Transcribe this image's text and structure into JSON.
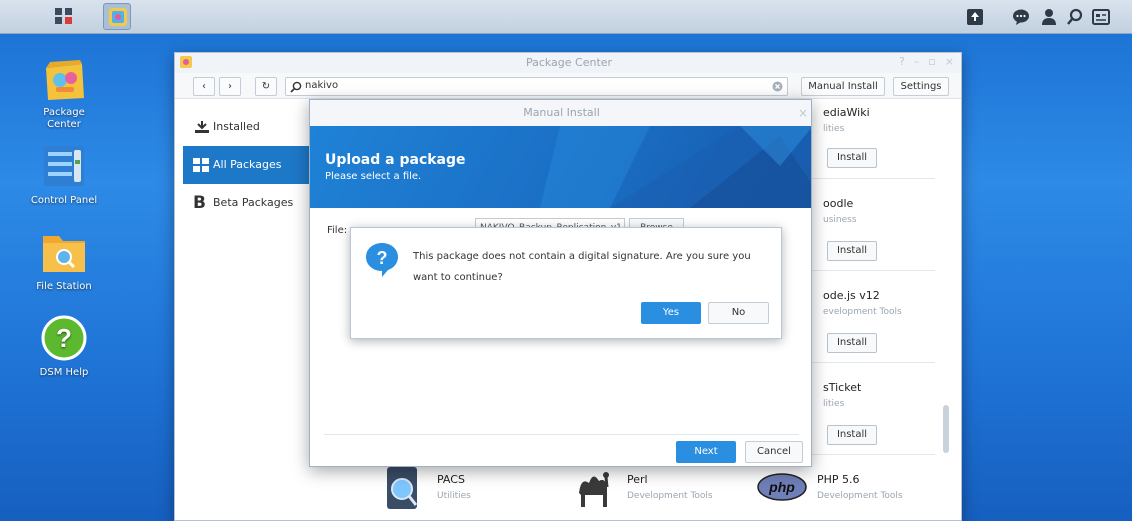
{
  "desktop": {
    "icons": [
      {
        "label": "Package\nCenter"
      },
      {
        "label": "Control Panel"
      },
      {
        "label": "File Station"
      },
      {
        "label": "DSM Help"
      }
    ]
  },
  "package_center": {
    "title": "Package Center",
    "search_value": "nakivo",
    "manual_install_label": "Manual Install",
    "settings_label": "Settings",
    "sidebar": [
      {
        "label": "Installed"
      },
      {
        "label": "All Packages"
      },
      {
        "label": "Beta Packages"
      }
    ],
    "packages": [
      {
        "name": "ediaWiki",
        "category": "lities",
        "action": "Install"
      },
      {
        "name": "oodle",
        "category": "usiness",
        "action": "Install"
      },
      {
        "name": "ode.js v12",
        "category": "evelopment Tools",
        "action": "Install"
      },
      {
        "name": "sTicket",
        "category": "lities",
        "action": "Install"
      },
      {
        "name": "PACS",
        "category": "Utilities"
      },
      {
        "name": "Perl",
        "category": "Development Tools"
      },
      {
        "name": "PHP 5.6",
        "category": "Development Tools"
      }
    ]
  },
  "manual_install": {
    "title": "Manual Install",
    "heading": "Upload a package",
    "subheading": "Please select a file.",
    "file_label": "File:",
    "file_value": "NAKIVO_Backup_Replication_v1",
    "browse_label": "Browse",
    "next_label": "Next",
    "cancel_label": "Cancel"
  },
  "confirm": {
    "message": "This package does not contain a digital signature. Are you sure you want to continue?",
    "yes_label": "Yes",
    "no_label": "No"
  },
  "colors": {
    "accent": "#1e78c8",
    "button_blue": "#2a8fe0"
  }
}
